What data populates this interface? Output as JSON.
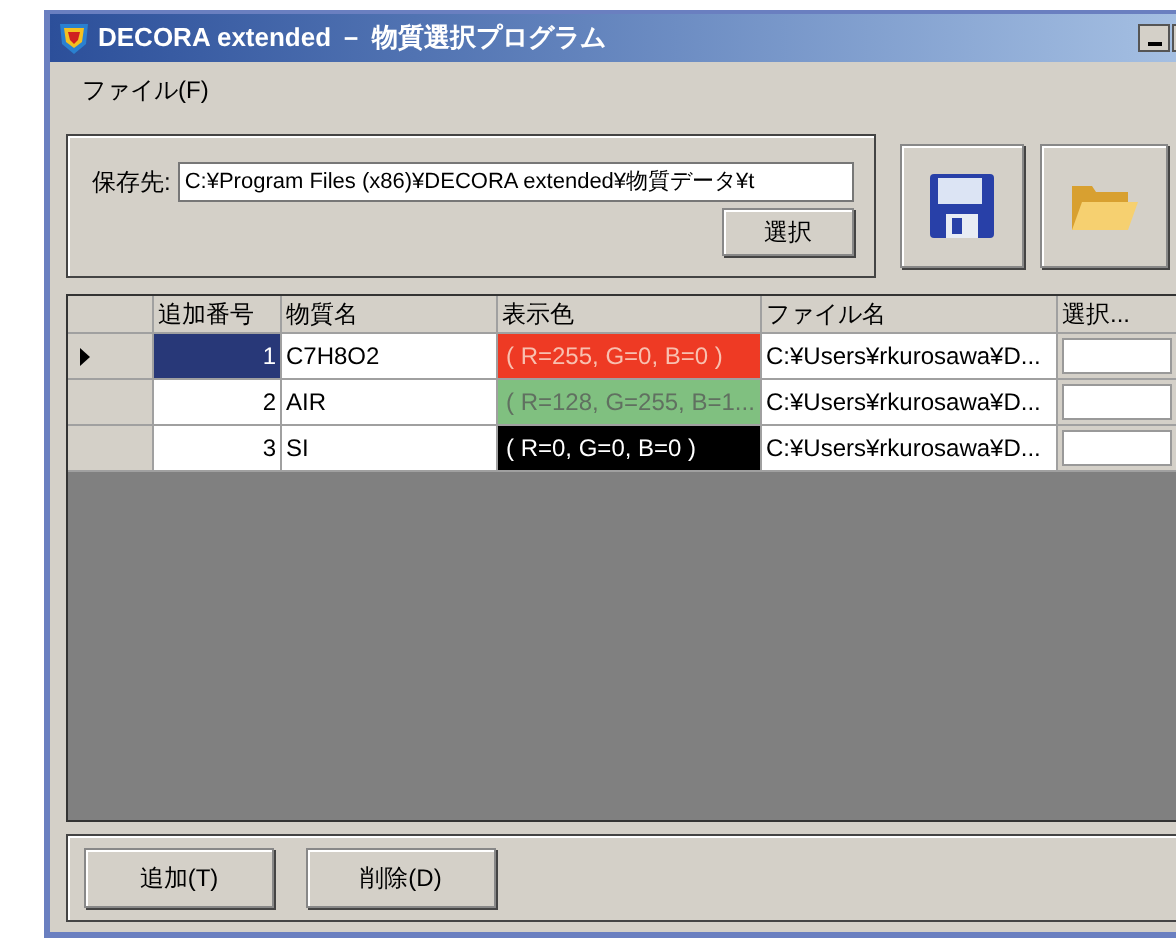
{
  "window": {
    "title": "DECORA extended － 物質選択プログラム"
  },
  "menu": [
    "ファイル(F)"
  ],
  "save": {
    "label": "保存先:",
    "value": "C:¥Program Files (x86)¥DECORA extended¥物質データ¥t",
    "button": "選択"
  },
  "grid": {
    "columns": [
      "追加番号",
      "物質名",
      "表示色",
      "ファイル名",
      "選択..."
    ],
    "rows": [
      {
        "selected": true,
        "number": "1",
        "name": "C7H8O2",
        "color_text": "( R=255, G=0, B=0 )",
        "color": "#ee3a24",
        "file": "C:¥Users¥rkurosawa¥D..."
      },
      {
        "selected": false,
        "number": "2",
        "name": "AIR",
        "color_text": "( R=128, G=255, B=1...",
        "color": "#80c080",
        "file": "C:¥Users¥rkurosawa¥D..."
      },
      {
        "selected": false,
        "number": "3",
        "name": "SI",
        "color_text": "( R=0, G=0, B=0 )",
        "color": "#000000",
        "file": "C:¥Users¥rkurosawa¥D..."
      }
    ]
  },
  "buttons": [
    "追加(T)",
    "削除(D)"
  ]
}
